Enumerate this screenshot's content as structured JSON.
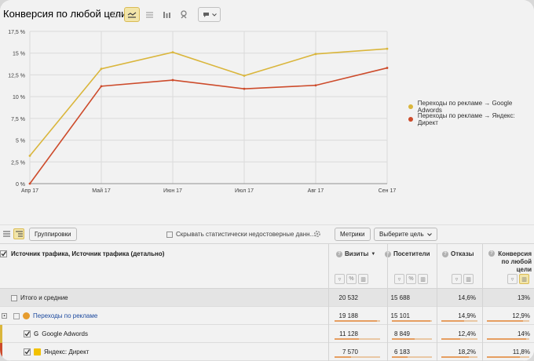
{
  "header": {
    "title": "Конверсия по любой цели",
    "toolbar_icons": [
      "refresh-icon",
      "line-chart-icon",
      "area-chart-icon",
      "bar-chart-icon",
      "map-icon",
      "chat-icon"
    ]
  },
  "chart_data": {
    "type": "line",
    "categories": [
      "Апр 17",
      "Май 17",
      "Июн 17",
      "Июл 17",
      "Авг 17",
      "Сен 17"
    ],
    "y_ticks": [
      "0 %",
      "2,5 %",
      "5 %",
      "7,5 %",
      "10 %",
      "12,5 %",
      "15 %",
      "17,5 %"
    ],
    "ylim": [
      0,
      17.5
    ],
    "grid": true,
    "legend_position": "right",
    "series": [
      {
        "name": "Переходы по рекламе → Google Adwords",
        "color": "#e6c040",
        "values": [
          3.2,
          13.2,
          15.1,
          12.4,
          14.9,
          15.5
        ]
      },
      {
        "name": "Переходы по рекламе → Яндекс: Директ",
        "color": "#d9502e",
        "values": [
          0.0,
          11.2,
          11.9,
          10.9,
          11.3,
          13.3
        ]
      }
    ]
  },
  "toolbar": {
    "groupings_label": "Группировки",
    "hide_stat_label": "Скрывать статистически недостоверные данн...",
    "metrics_label": "Метрики",
    "choose_goal_label": "Выберите цель"
  },
  "table": {
    "dimension_header": "Источник трафика, Источник трафика (детально)",
    "columns": [
      {
        "label": "Визиты",
        "sort": "▼"
      },
      {
        "label": "Посетители"
      },
      {
        "label": "Отказы"
      },
      {
        "label": "Конверсия по любой цели"
      }
    ],
    "total": {
      "label": "Итого и средние",
      "values": [
        "20 532",
        "15 688",
        "14,6%",
        "13%"
      ]
    },
    "rows": [
      {
        "label": "Переходы по рекламе",
        "values": [
          "19 188",
          "15 101",
          "14,9%",
          "12,9%"
        ],
        "bars": [
          0.93,
          0.96,
          0.62,
          0.85
        ]
      },
      {
        "label": "Google Adwords",
        "values": [
          "11 128",
          "8 849",
          "12,4%",
          "14%"
        ],
        "bars": [
          0.54,
          0.56,
          0.52,
          0.93
        ],
        "color": "#e6c040"
      },
      {
        "label": "Яндекс: Директ",
        "values": [
          "7 570",
          "6 183",
          "18,2%",
          "11,8%"
        ],
        "bars": [
          0.37,
          0.39,
          0.76,
          0.78
        ],
        "color": "#d9502e"
      }
    ]
  }
}
